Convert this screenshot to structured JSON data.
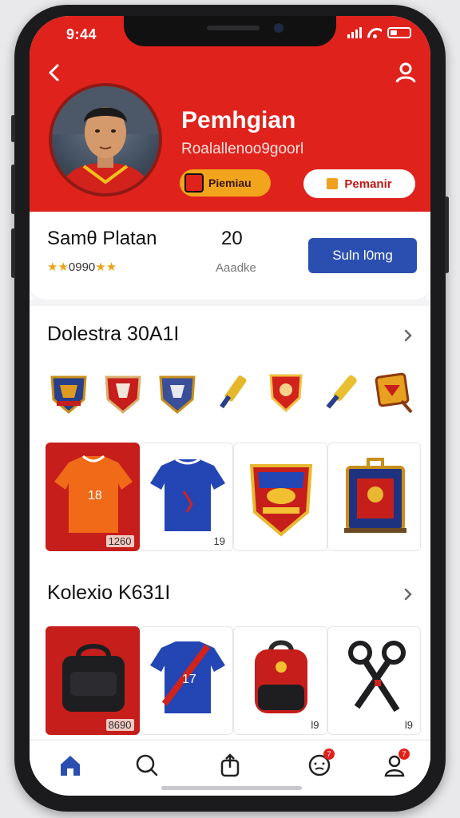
{
  "status_bar": {
    "time": "9:44"
  },
  "header": {
    "name": "Pemhgian",
    "subtitle": "Roalallenoo9goorl",
    "badge_label": "Piemiau",
    "pill_label": "Pemanir"
  },
  "stats": {
    "name": "Samθ Platan",
    "rating_text": "0990",
    "number": "20",
    "number_label": "Aaadke",
    "cta_label": "Suln l0mg"
  },
  "sections": [
    {
      "title": "Dolestra 30A1I",
      "badges": [
        "shield-badge-icon",
        "shield-badge-icon",
        "shield-badge-icon",
        "cricket-bat-icon",
        "shield-badge-icon",
        "cricket-bat-icon",
        "flag-badge-icon"
      ],
      "cards": [
        {
          "icon": "orange-jersey",
          "tag": "1260"
        },
        {
          "icon": "blue-jersey",
          "tag": "19"
        },
        {
          "icon": "crest-badge",
          "tag": ""
        },
        {
          "icon": "box-trophy",
          "tag": ""
        }
      ]
    },
    {
      "title": "Kolexio K631I",
      "cards": [
        {
          "icon": "black-bag",
          "tag": "8690"
        },
        {
          "icon": "blue-jersey-2",
          "tag": ""
        },
        {
          "icon": "red-backpack",
          "tag": "l9"
        },
        {
          "icon": "scissors-tool",
          "tag": "l9"
        }
      ]
    }
  ],
  "tabbar": {
    "items": [
      "home-icon",
      "search-icon",
      "share-icon",
      "messages-icon",
      "profile-icon"
    ],
    "badges": {
      "messages": "7",
      "profile": "7"
    }
  },
  "colors": {
    "primary": "#e0221d",
    "accent": "#f2a51c",
    "cta": "#2a4fb0"
  }
}
